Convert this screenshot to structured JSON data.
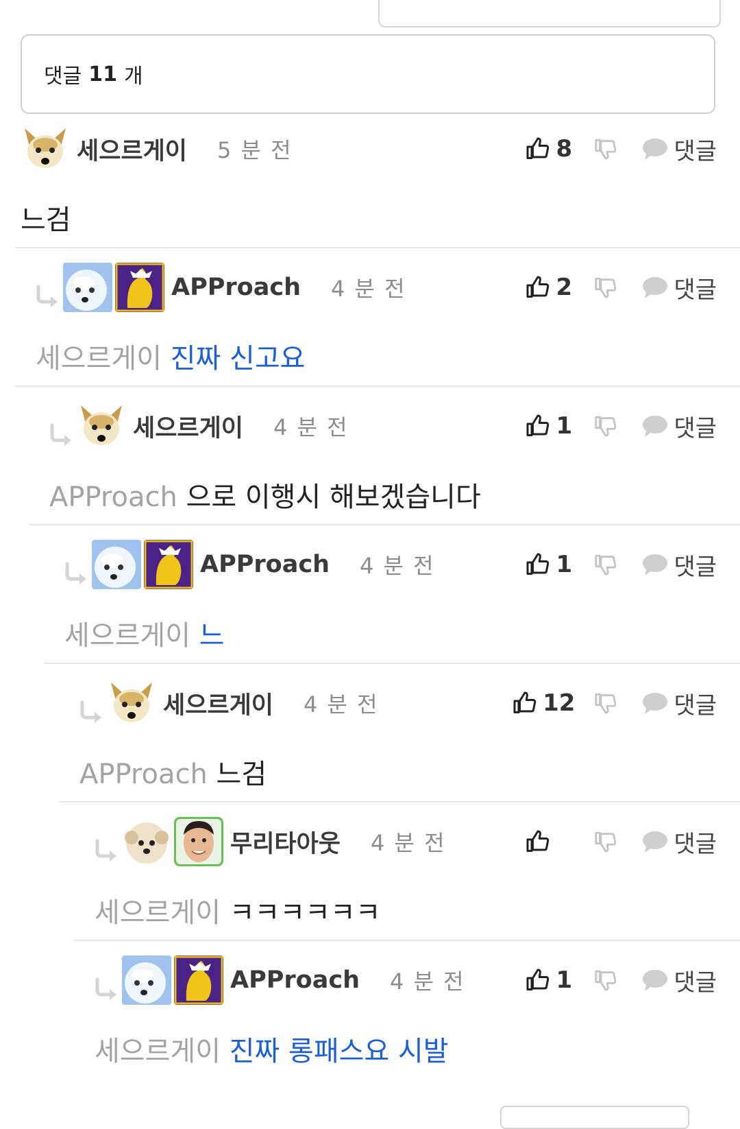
{
  "header": {
    "count_prefix": "댓글",
    "count": "11",
    "count_suffix": "개"
  },
  "actions": {
    "reply_label": "댓글"
  },
  "comments": [
    {
      "author": "세으르게이",
      "time": "5 분 전",
      "likes": "8",
      "mention": "",
      "text": "느검",
      "text_color": "default",
      "avatars": [
        "fox"
      ]
    },
    {
      "author": "APProach",
      "time": "4 분 전",
      "likes": "2",
      "mention": "세으르게이",
      "text": "진짜 신고요",
      "text_color": "blue",
      "avatars": [
        "dog",
        "crest"
      ]
    },
    {
      "author": "세으르게이",
      "time": "4 분 전",
      "likes": "1",
      "mention": "APProach",
      "text": "으로 이행시 해보겠습니다",
      "text_color": "default",
      "avatars": [
        "fox"
      ]
    },
    {
      "author": "APProach",
      "time": "4 분 전",
      "likes": "1",
      "mention": "세으르게이",
      "text": "느",
      "text_color": "blue",
      "avatars": [
        "dog",
        "crest"
      ]
    },
    {
      "author": "세으르게이",
      "time": "4 분 전",
      "likes": "12",
      "mention": "APProach",
      "text": "느검",
      "text_color": "default",
      "avatars": [
        "fox"
      ]
    },
    {
      "author": "무리타아웃",
      "time": "4 분 전",
      "likes": "",
      "mention": "세으르게이",
      "text": "ㅋㅋㅋㅋㅋㅋ",
      "text_color": "default",
      "avatars": [
        "puppy",
        "face"
      ]
    },
    {
      "author": "APProach",
      "time": "4 분 전",
      "likes": "1",
      "mention": "세으르게이",
      "text": "진짜 롱패스요 시발",
      "text_color": "blue",
      "avatars": [
        "dog",
        "crest"
      ]
    }
  ]
}
